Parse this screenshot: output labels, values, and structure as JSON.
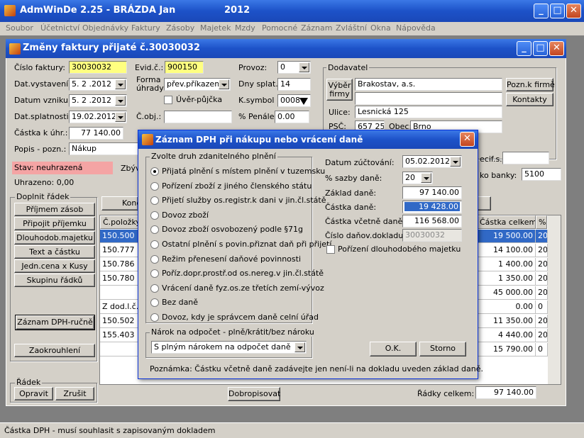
{
  "app": {
    "title": "AdmWinDe 2.25 - BRÁZDA Jan",
    "year": "2012",
    "menu": [
      "Soubor",
      "Účetnictví",
      "Objednávky",
      "Faktury",
      "Zásoby",
      "Majetek",
      "Mzdy",
      "Pomocné",
      "Záznam",
      "Zvláštní",
      "Okna",
      "Nápověda"
    ]
  },
  "invoice_window": {
    "title": "Změny faktury přijaté č.30030032",
    "cislo_faktury_label": "Číslo faktury:",
    "cislo_faktury": "30030032",
    "evid_label": "Evid.č.:",
    "evid": "900150",
    "provoz_label": "Provoz:",
    "provoz": "0",
    "dat_vystaveni_label": "Dat.vystavení:",
    "dat_vystaveni": "5. 2 .2012",
    "forma_label_1": "Forma",
    "forma_label_2": "úhrady:",
    "forma": "přev.příkazem",
    "dny_splat_label": "Dny splat.:",
    "dny_splat": "14",
    "datum_vzniku_label": "Datum vzniku:",
    "datum_vzniku": "5. 2 .2012",
    "uver_label": "Úvěr-půjčka",
    "ksymbol_label": "K.symbol :",
    "ksymbol": "0008",
    "dat_splat_label": "Dat.splatnosti:",
    "dat_splat": "19.02.2012",
    "cobj_label": "Č.obj.:",
    "penale_label": "% Penále:",
    "penale": "0.00",
    "castka_label": "Částka k úhr.:",
    "castka": "77 140.00",
    "popis_label": "Popis - pozn.:",
    "popis": "Nákup",
    "stav": "Stav: neuhrazená",
    "zbyva_partial": "Zbýv",
    "uhrazeno": "Uhrazeno: 0,00",
    "dodavatel_title": "Dodavatel",
    "vyber_firmy_1": "Výběr",
    "vyber_firmy_2": "firmy",
    "firma": "Brakostav, a.s.",
    "pozn_firme": "Pozn.k firmě",
    "kontakty": "Kontakty",
    "ulice_label": "Ulice:",
    "ulice": "Lesnická 125",
    "psc_label": "PSČ:",
    "psc": "657 25",
    "obec_label": "Obec:",
    "obec": "Brno",
    "specif_label": "ecif.s.:",
    "kod_banky_label": "ko banky:",
    "kod_banky": "5100",
    "doplnit_title": "Doplnit řádek",
    "buttons": [
      "Příjmem zásob",
      "Připojit příjemku",
      "Dlouhodob.majetku",
      "Text a částku",
      "Jedn.cena x Kusy",
      "Skupinu řádků"
    ],
    "zaznam_dph_rucne": "Záznam DPH-ručně",
    "zaokrouhleni": "Zaokrouhlení",
    "radek_title": "Řádek",
    "opravit": "Opravit",
    "zrusit": "Zrušit",
    "kone_partial": "Kone",
    "dobropisovat": "Dobropisovat",
    "radky_celkem_label": "Řádky celkem:",
    "radky_celkem": "97 140.00"
  },
  "grid": {
    "headers": {
      "polozka": "Č.položky",
      "castka_celkem": "Částka celkem",
      "pct": "%"
    },
    "rows": [
      {
        "pol": "150.500",
        "castka": "19 500.00",
        "pct": "20",
        "selected": true
      },
      {
        "pol": "150.777",
        "castka": "14 100.00",
        "pct": "20"
      },
      {
        "pol": "150.786",
        "castka": "1 400.00",
        "pct": "20"
      },
      {
        "pol": "150.780",
        "castka": "1 350.00",
        "pct": "20"
      },
      {
        "pol": "",
        "castka": "45 000.00",
        "pct": "20"
      },
      {
        "pol": "Z dod.l.č.",
        "castka": "0.00",
        "pct": "0"
      },
      {
        "pol": "150.502",
        "castka": "11 350.00",
        "pct": "20"
      },
      {
        "pol": "155.403",
        "castka": "4 440.00",
        "pct": "20"
      },
      {
        "pol": "",
        "castka": "15 790.00",
        "pct": "0"
      }
    ]
  },
  "dialog": {
    "title": "Záznam DPH při nákupu nebo vrácení daně",
    "group_title": "Zvolte druh zdanitelného plnění",
    "options": [
      "Přijatá plnění s místem plnění v tuzemsku",
      "Pořízení zboží z jiného členského státu",
      "Přijetí služby os.registr.k dani v jin.čl.státě",
      "Dovoz zboží",
      "Dovoz zboží osvobozený podle §71g",
      "Ostatní plnění s povin.přiznat daň při přijetí",
      "Režim přenesení daňové povinnosti",
      "Poříz.dopr.prostř.od os.nereg.v jin.čl.státě",
      "Vrácení daně fyz.os.ze třetích zemí-vývoz",
      "Bez daně",
      "Dovoz, kdy je správcem daně celní úřad"
    ],
    "selected_option": 0,
    "narok_title": "Nárok na odpočet - plně/krátit/bez nároku",
    "narok_value": "S plným nárokem na odpočet daně",
    "datum_label": "Datum zúčtování:",
    "datum": "05.02.2012",
    "sazba_label": "% sazby daně:",
    "sazba": "20",
    "zaklad_label": "Základ daně:",
    "zaklad": "97 140.00",
    "castka_dane_label": "Částka daně:",
    "castka_dane": "19 428.00",
    "castka_vc_label": "Částka včetně daně:",
    "castka_vc": "116 568.00",
    "cislo_dokl_label": "Číslo daňov.dokladu:",
    "cislo_dokl": "30030032",
    "porizeni_label": "Pořízení dlouhodobého majetku",
    "ok": "O.K.",
    "storno": "Storno",
    "poznamka": "Poznámka: Částku včetně daně zadávejte jen není-li na dokladu uveden základ daně."
  },
  "status": "Částka DPH - musí souhlasit s zapisovaným dokladem"
}
